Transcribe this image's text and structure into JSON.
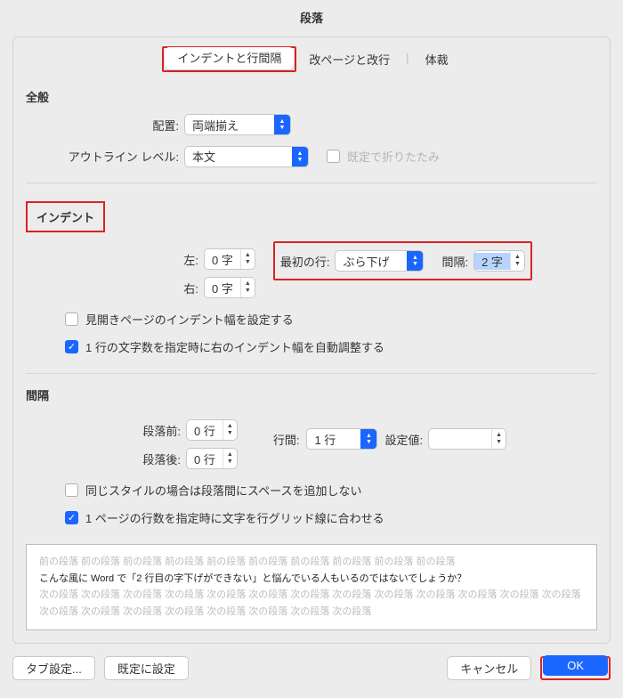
{
  "title": "段落",
  "tabs": {
    "t1": "インデントと行間隔",
    "t2": "改ページと改行",
    "t3": "体裁"
  },
  "general": {
    "heading": "全般",
    "align_label": "配置:",
    "align_value": "両端揃え",
    "outline_label": "アウトライン レベル:",
    "outline_value": "本文",
    "fold_label": "既定で折りたたみ"
  },
  "indent": {
    "heading": "インデント",
    "left_label": "左:",
    "left_value": "0 字",
    "right_label": "右:",
    "right_value": "0 字",
    "first_label": "最初の行:",
    "first_value": "ぶら下げ",
    "gap_label": "間隔:",
    "gap_value": "2 字",
    "chk1": "見開きページのインデント幅を設定する",
    "chk2": "1 行の文字数を指定時に右のインデント幅を自動調整する"
  },
  "spacing": {
    "heading": "間隔",
    "before_label": "段落前:",
    "before_value": "0 行",
    "after_label": "段落後:",
    "after_value": "0 行",
    "line_label": "行間:",
    "line_value": "1 行",
    "set_label": "設定値:",
    "set_value": "",
    "chk1": "同じスタイルの場合は段落間にスペースを追加しない",
    "chk2": "1 ページの行数を指定時に文字を行グリッド線に合わせる"
  },
  "preview": {
    "prev": "前の段落  前の段落  前の段落  前の段落  前の段落  前の段落  前の段落  前の段落  前の段落  前の段落",
    "main": "こんな風に Word で「2 行目の字下げができない」と悩んでいる人もいるのではないでしょうか？",
    "next": "次の段落  次の段落  次の段落  次の段落  次の段落  次の段落  次の段落  次の段落  次の段落  次の段落  次の段落  次の段落  次の段落  次の段落  次の段落  次の段落  次の段落  次の段落  次の段落  次の段落  次の段落"
  },
  "footer": {
    "tab": "タブ設定...",
    "default": "既定に設定",
    "cancel": "キャンセル",
    "ok": "OK"
  }
}
